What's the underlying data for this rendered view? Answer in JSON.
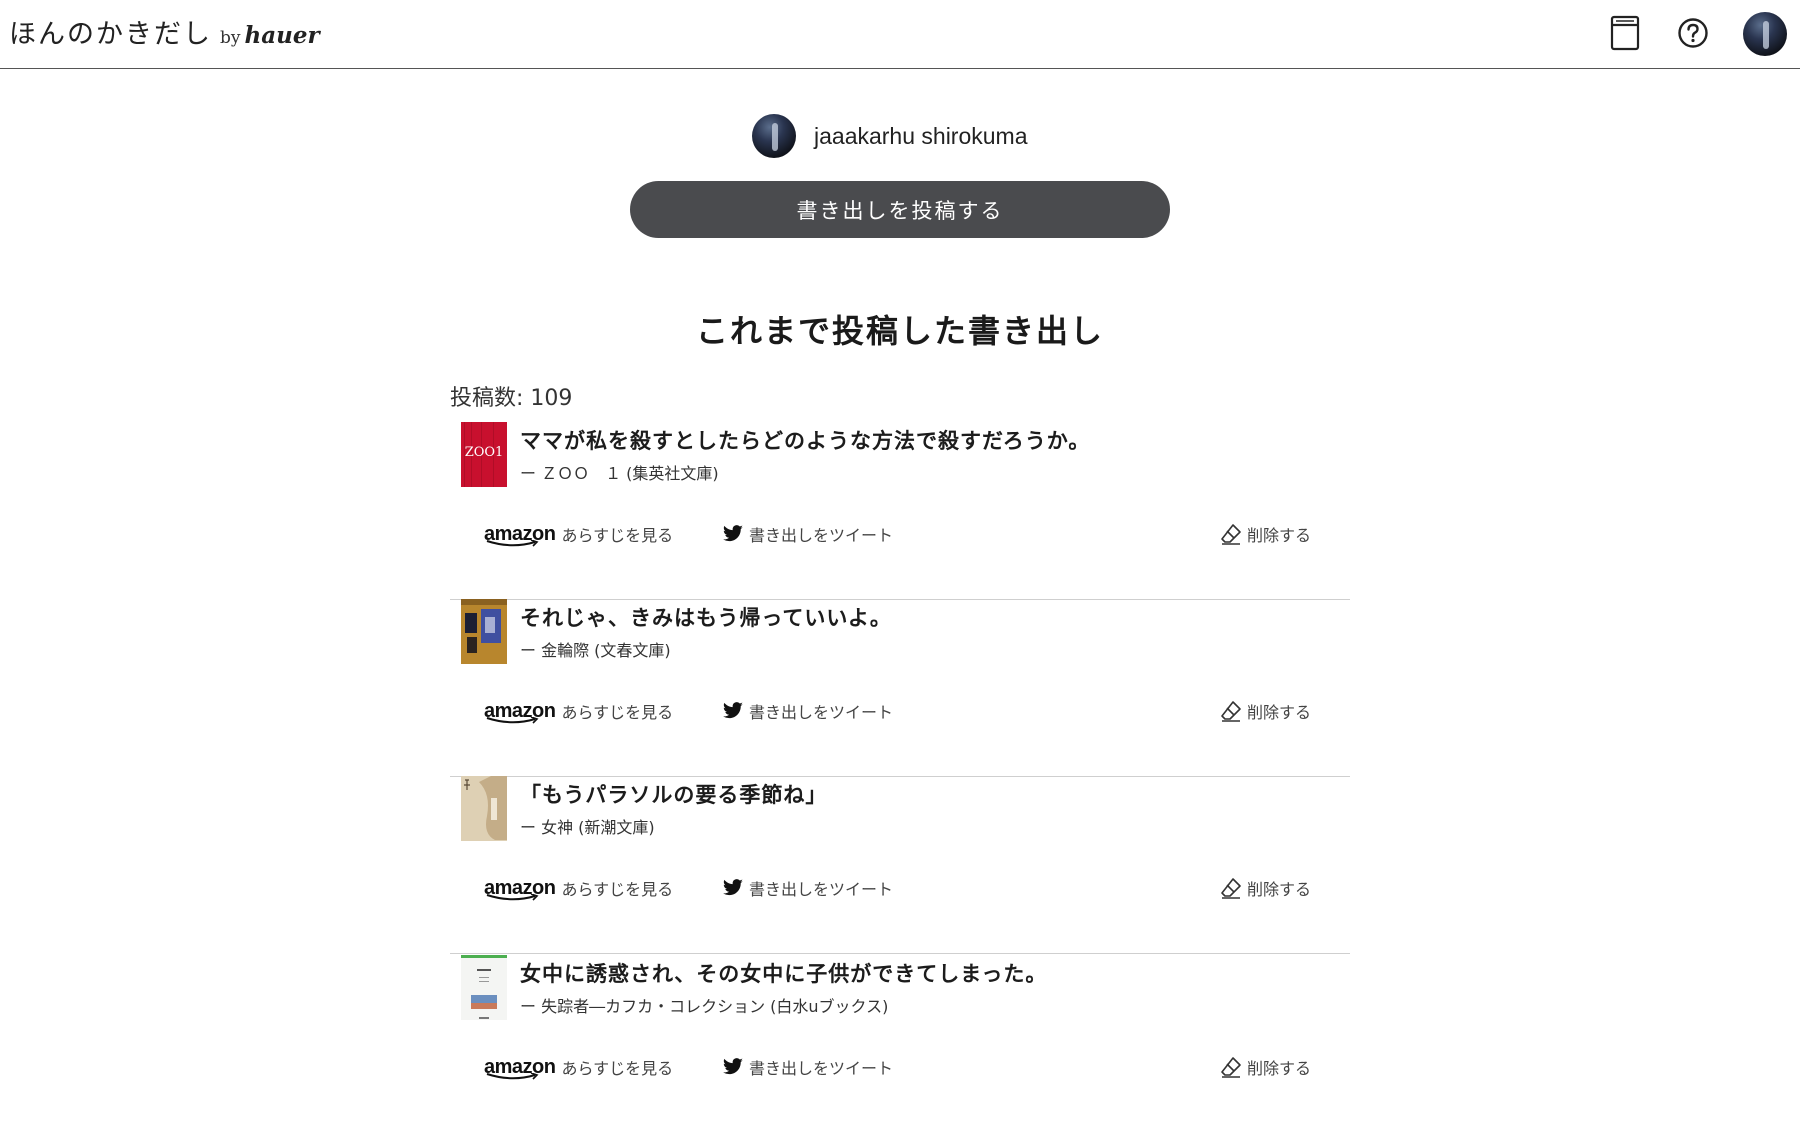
{
  "header": {
    "logo_main": "ほんのかきだし",
    "logo_by": "by",
    "logo_brand": "hauer",
    "icons": [
      "book-icon",
      "help-icon",
      "user-avatar"
    ]
  },
  "profile": {
    "username": "jaaakarhu shirokuma",
    "post_button_label": "書き出しを投稿する"
  },
  "main": {
    "section_title": "これまで投稿した書き出し",
    "post_count_label": "投稿数: 109"
  },
  "entries": [
    {
      "quote": "ママが私を殺すとしたらどのような方法で殺すだろうか。",
      "book": "ー ＺＯＯ　１ (集英社文庫)",
      "cover_color": "#c8102e",
      "cover_text": "ZOO1"
    },
    {
      "quote": "それじゃ、きみはもう帰っていいよ。",
      "book": "ー 金輪際 (文春文庫)",
      "cover_color": "#b8862d"
    },
    {
      "quote": "「もうパラソルの要る季節ね」",
      "book": "ー 女神 (新潮文庫)",
      "cover_color": "#d9c8a8"
    },
    {
      "quote": "女中に誘惑され、その女中に子供ができてしまった。",
      "book": "ー 失踪者―カフカ・コレクション (白水uブックス)",
      "cover_color": "#f2f4f2"
    }
  ],
  "actions": {
    "amazon_brand": "amazon",
    "amazon_label": "あらすじを見る",
    "tweet_label": "書き出しをツイート",
    "delete_label": "削除する"
  }
}
